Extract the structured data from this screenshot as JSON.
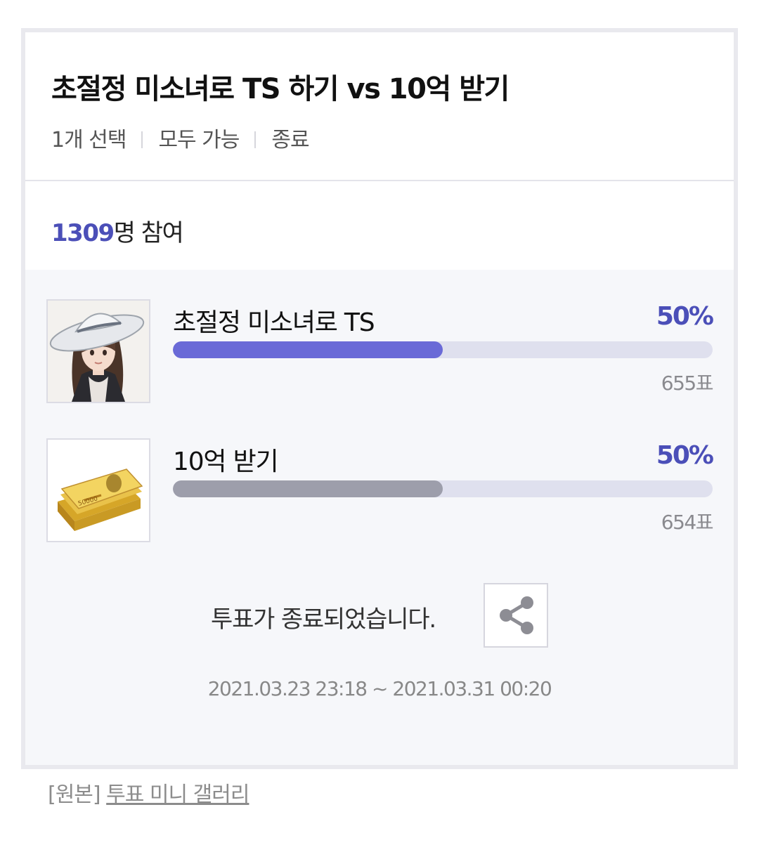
{
  "poll": {
    "title": "초절정 미소녀로 TS 하기 vs 10억 받기",
    "meta": [
      "1개 선택",
      "모두 가능",
      "종료"
    ],
    "participants": {
      "count": "1309",
      "suffix": "명 참여"
    },
    "options": [
      {
        "label": "초절정 미소녀로 TS",
        "percent": "50%",
        "percent_value": 50,
        "votes": "655표",
        "image": "girl-in-sunhat-icon"
      },
      {
        "label": "10억 받기",
        "percent": "50%",
        "percent_value": 50,
        "votes": "654표",
        "image": "money-stack-icon"
      }
    ],
    "status": "투표가 종료되었습니다.",
    "period": "2021.03.23 23:18 ~ 2021.03.31 00:20",
    "share_icon": "share-icon"
  },
  "footer": {
    "prefix": "[원본]",
    "link": "투표 미니 갤러리"
  },
  "colors": {
    "accent": "#4b4fb8",
    "bar_leader": "#6a6ad7",
    "bar_other": "#9d9eab",
    "bar_track": "#dfe0ee",
    "panel_bg": "#f6f7fa"
  }
}
